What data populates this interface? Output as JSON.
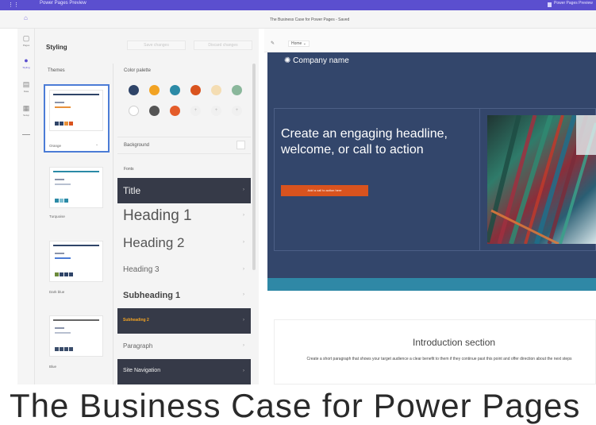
{
  "topbar": {
    "app_name": "Power Pages Preview",
    "user": "Power Pages Preview"
  },
  "document": {
    "title": "The Business Case for Power Pages - Saved"
  },
  "rail": [
    {
      "label": "Pages",
      "icon": "pages-icon"
    },
    {
      "label": "Styling",
      "icon": "styling-icon"
    },
    {
      "label": "Data",
      "icon": "data-icon"
    },
    {
      "label": "Setup",
      "icon": "setup-icon"
    }
  ],
  "panel": {
    "title": "Styling",
    "buttons": [
      "Save changes",
      "Discard changes"
    ],
    "themes_label": "Themes",
    "themes": [
      {
        "name": "Orange",
        "dropdown": "⌄"
      },
      {
        "name": "Turquoise"
      },
      {
        "name": "Dark blue"
      },
      {
        "name": "Blue"
      }
    ],
    "palette_label": "Color palette",
    "palette": [
      "#2f4468",
      "#f2a323",
      "#2b8aa6",
      "#d9531e",
      "#f4ddb3",
      "#8ab79b",
      "#ffffff",
      "#555555",
      "#e45c2a"
    ],
    "background_label": "Background",
    "fonts_label": "Fonts",
    "fonts": [
      "Title",
      "Heading 1",
      "Heading 2",
      "Heading 3",
      "Subheading 1",
      "Subheading 2",
      "Paragraph",
      "Site Navigation"
    ]
  },
  "canvas": {
    "toolbar_dropdown": "Home ⌄",
    "company_name": "Company name",
    "headline": "Create an engaging headline, welcome, or call to action",
    "cta": "Add a call to action here",
    "intro_title": "Introduction section",
    "intro_text": "Create a short paragraph that shows your target audience a clear benefit to them if they continue past this point and offer direction about the next steps"
  },
  "big_title": "The Business Case for Power Pages"
}
